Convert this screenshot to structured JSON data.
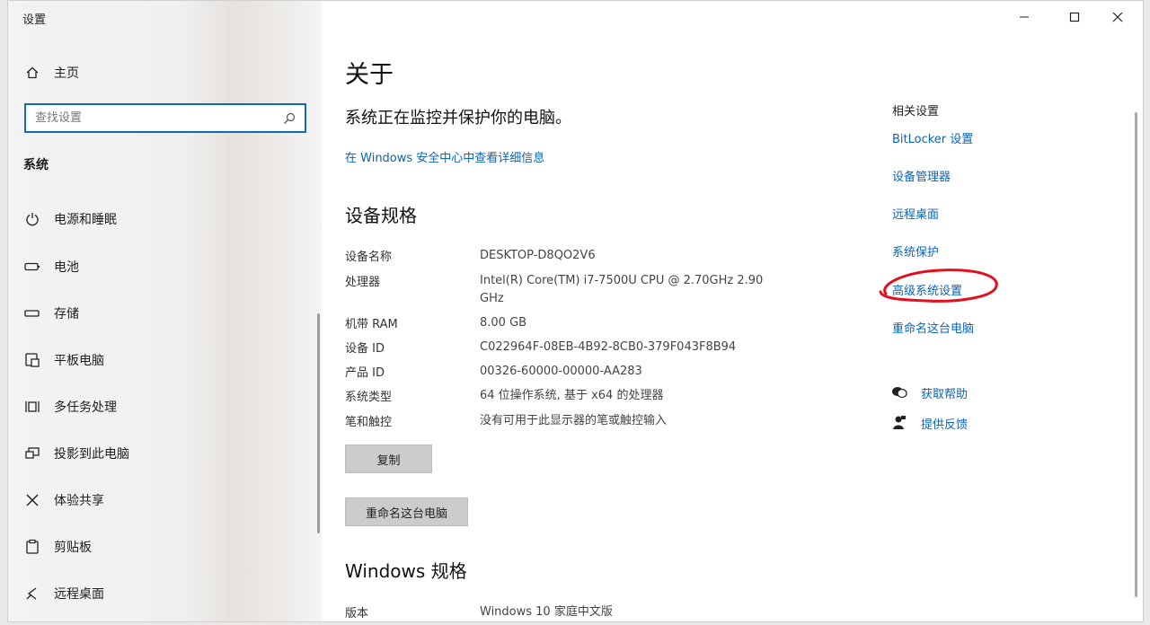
{
  "window": {
    "app_title": "设置",
    "controls": [
      "minimize",
      "maximize",
      "close"
    ]
  },
  "sidebar": {
    "home_label": "主页",
    "search_placeholder": "查找设置",
    "section_label": "系统",
    "items": [
      {
        "label": "电源和睡眠",
        "icon": "power-icon"
      },
      {
        "label": "电池",
        "icon": "battery-icon"
      },
      {
        "label": "存储",
        "icon": "storage-icon"
      },
      {
        "label": "平板电脑",
        "icon": "tablet-icon"
      },
      {
        "label": "多任务处理",
        "icon": "multitask-icon"
      },
      {
        "label": "投影到此电脑",
        "icon": "project-icon"
      },
      {
        "label": "体验共享",
        "icon": "share-icon"
      },
      {
        "label": "剪贴板",
        "icon": "clipboard-icon"
      },
      {
        "label": "远程桌面",
        "icon": "remote-desktop-icon"
      }
    ]
  },
  "main": {
    "title": "关于",
    "protect_text": "系统正在监控并保护你的电脑。",
    "security_link": "在 Windows 安全中心中查看详细信息",
    "spec_heading": "设备规格",
    "specs": [
      {
        "label": "设备名称",
        "value": "DESKTOP-D8QO2V6"
      },
      {
        "label": "处理器",
        "value": "Intel(R) Core(TM) i7-7500U CPU @ 2.70GHz   2.90 GHz"
      },
      {
        "label": "机带 RAM",
        "value": "8.00 GB"
      },
      {
        "label": "设备 ID",
        "value": "C022964F-08EB-4B92-8CB0-379F043F8B94"
      },
      {
        "label": "产品 ID",
        "value": "00326-60000-00000-AA283"
      },
      {
        "label": "系统类型",
        "value": "64 位操作系统, 基于 x64 的处理器"
      },
      {
        "label": "笔和触控",
        "value": "没有可用于此显示器的笔或触控输入"
      }
    ],
    "copy_button": "复制",
    "rename_button": "重命名这台电脑",
    "windows_heading": "Windows 规格",
    "windows_specs": [
      {
        "label": "版本",
        "value": "Windows 10 家庭中文版"
      }
    ]
  },
  "related": {
    "title": "相关设置",
    "links": [
      "BitLocker 设置",
      "设备管理器",
      "远程桌面",
      "系统保护",
      "高级系统设置",
      "重命名这台电脑"
    ],
    "help_label": "获取帮助",
    "feedback_label": "提供反馈",
    "annotation_color": "#e0101c"
  },
  "accent_color": "#0b63b6"
}
